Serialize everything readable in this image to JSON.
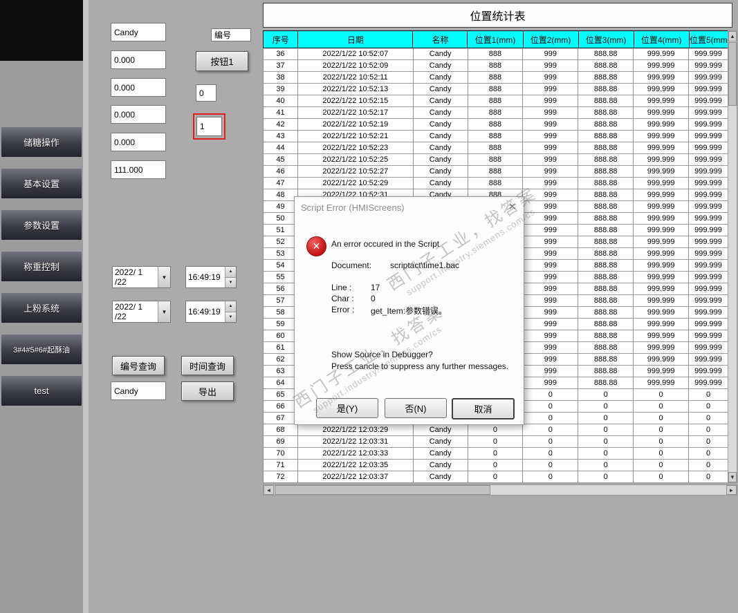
{
  "colors": {
    "header_bg": "#00ffff",
    "highlight_red": "#e51c1c"
  },
  "icons": {
    "close": "✕",
    "error": "✕",
    "dropdown": "▼",
    "spin_up": "▲",
    "spin_down": "▼",
    "arrow_up": "▲",
    "arrow_down": "▼",
    "arrow_left": "◄",
    "arrow_right": "►"
  },
  "sidebar": {
    "items": [
      "储糖操作",
      "基本设置",
      "参数设置",
      "称重控制",
      "上粉系统",
      "3#4#5#6#起酥油",
      "test"
    ]
  },
  "panel": {
    "product_name": "Candy",
    "values": [
      "0.000",
      "0.000",
      "0.000",
      "0.000",
      "111.000"
    ],
    "id_label": "编号",
    "button1_label": "按钮1",
    "field0": "0",
    "field1": "1",
    "start_date": "2022/ 1 /22",
    "start_time": "16:49:19",
    "end_date": "2022/ 1 /22",
    "end_time": "16:49:19",
    "query_by_id": "编号查询",
    "query_by_time": "时间查询",
    "search_name": "Candy",
    "export": "导出"
  },
  "table": {
    "title": "位置统计表",
    "headers": [
      "序号",
      "日期",
      "名称",
      "位置1(mm)",
      "位置2(mm)",
      "位置3(mm)",
      "位置4(mm)",
      "位置5(mm"
    ],
    "rows": [
      [
        "36",
        "2022/1/22 10:52:07",
        "Candy",
        "888",
        "999",
        "888.88",
        "999.999",
        "999.999"
      ],
      [
        "37",
        "2022/1/22 10:52:09",
        "Candy",
        "888",
        "999",
        "888.88",
        "999.999",
        "999.999"
      ],
      [
        "38",
        "2022/1/22 10:52:11",
        "Candy",
        "888",
        "999",
        "888.88",
        "999.999",
        "999.999"
      ],
      [
        "39",
        "2022/1/22 10:52:13",
        "Candy",
        "888",
        "999",
        "888.88",
        "999.999",
        "999.999"
      ],
      [
        "40",
        "2022/1/22 10:52:15",
        "Candy",
        "888",
        "999",
        "888.88",
        "999.999",
        "999.999"
      ],
      [
        "41",
        "2022/1/22 10:52:17",
        "Candy",
        "888",
        "999",
        "888.88",
        "999.999",
        "999.999"
      ],
      [
        "42",
        "2022/1/22 10:52:19",
        "Candy",
        "888",
        "999",
        "888.88",
        "999.999",
        "999.999"
      ],
      [
        "43",
        "2022/1/22 10:52:21",
        "Candy",
        "888",
        "999",
        "888.88",
        "999.999",
        "999.999"
      ],
      [
        "44",
        "2022/1/22 10:52:23",
        "Candy",
        "888",
        "999",
        "888.88",
        "999.999",
        "999.999"
      ],
      [
        "45",
        "2022/1/22 10:52:25",
        "Candy",
        "888",
        "999",
        "888.88",
        "999.999",
        "999.999"
      ],
      [
        "46",
        "2022/1/22 10:52:27",
        "Candy",
        "888",
        "999",
        "888.88",
        "999.999",
        "999.999"
      ],
      [
        "47",
        "2022/1/22 10:52:29",
        "Candy",
        "888",
        "999",
        "888.88",
        "999.999",
        "999.999"
      ],
      [
        "48",
        "2022/1/22 10:52:31",
        "Candy",
        "888",
        "999",
        "888.88",
        "999.999",
        "999.999"
      ],
      [
        "49",
        "",
        "",
        "",
        "999",
        "888.88",
        "999.999",
        "999.999"
      ],
      [
        "50",
        "",
        "",
        "",
        "999",
        "888.88",
        "999.999",
        "999.999"
      ],
      [
        "51",
        "",
        "",
        "",
        "999",
        "888.88",
        "999.999",
        "999.999"
      ],
      [
        "52",
        "",
        "",
        "",
        "999",
        "888.88",
        "999.999",
        "999.999"
      ],
      [
        "53",
        "",
        "",
        "",
        "999",
        "888.88",
        "999.999",
        "999.999"
      ],
      [
        "54",
        "",
        "",
        "",
        "999",
        "888.88",
        "999.999",
        "999.999"
      ],
      [
        "55",
        "",
        "",
        "",
        "999",
        "888.88",
        "999.999",
        "999.999"
      ],
      [
        "56",
        "",
        "",
        "",
        "999",
        "888.88",
        "999.999",
        "999.999"
      ],
      [
        "57",
        "",
        "",
        "",
        "999",
        "888.88",
        "999.999",
        "999.999"
      ],
      [
        "58",
        "",
        "",
        "",
        "999",
        "888.88",
        "999.999",
        "999.999"
      ],
      [
        "59",
        "",
        "",
        "",
        "999",
        "888.88",
        "999.999",
        "999.999"
      ],
      [
        "60",
        "",
        "",
        "",
        "999",
        "888.88",
        "999.999",
        "999.999"
      ],
      [
        "61",
        "",
        "",
        "",
        "999",
        "888.88",
        "999.999",
        "999.999"
      ],
      [
        "62",
        "",
        "",
        "",
        "999",
        "888.88",
        "999.999",
        "999.999"
      ],
      [
        "63",
        "",
        "",
        "",
        "999",
        "888.88",
        "999.999",
        "999.999"
      ],
      [
        "64",
        "",
        "",
        "",
        "999",
        "888.88",
        "999.999",
        "999.999"
      ],
      [
        "65",
        "",
        "",
        "",
        "0",
        "0",
        "0",
        "0"
      ],
      [
        "66",
        "",
        "",
        "",
        "0",
        "0",
        "0",
        "0"
      ],
      [
        "67",
        "",
        "",
        "",
        "0",
        "0",
        "0",
        "0"
      ],
      [
        "68",
        "2022/1/22 12:03:29",
        "Candy",
        "0",
        "0",
        "0",
        "0",
        "0"
      ],
      [
        "69",
        "2022/1/22 12:03:31",
        "Candy",
        "0",
        "0",
        "0",
        "0",
        "0"
      ],
      [
        "70",
        "2022/1/22 12:03:33",
        "Candy",
        "0",
        "0",
        "0",
        "0",
        "0"
      ],
      [
        "71",
        "2022/1/22 12:03:35",
        "Candy",
        "0",
        "0",
        "0",
        "0",
        "0"
      ],
      [
        "72",
        "2022/1/22 12:03:37",
        "Candy",
        "0",
        "0",
        "0",
        "0",
        "0"
      ]
    ]
  },
  "dialog": {
    "title": "Script Error (HMIScreens)",
    "message": "An error occured in the Script",
    "document_label": "Document:",
    "document_value": "scriptact\\time1.bac",
    "line_label": "Line :",
    "line_value": "17",
    "char_label": "Char :",
    "char_value": "0",
    "error_label": "Error :",
    "error_value": "get_Item:参数错误。",
    "question": "Show Source in Debugger?",
    "note": "Press cancle to suppress any further messages.",
    "buttons": {
      "yes": "是(Y)",
      "no": "否(N)",
      "cancel": "取消"
    }
  },
  "watermark": {
    "line1": "西门子工业，找答案",
    "line2": "support.industry.siemens.com/cs"
  }
}
